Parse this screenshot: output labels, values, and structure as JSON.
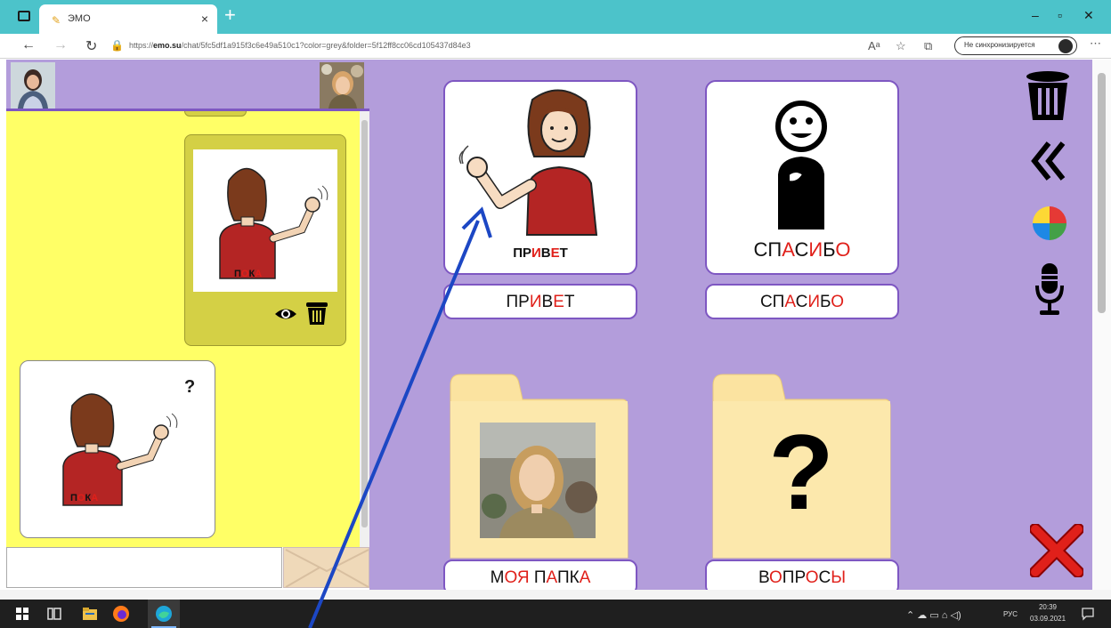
{
  "browser": {
    "tab_title": "ЭМО",
    "url_prefix": "https://",
    "url_host": "emo.su",
    "url_path": "/chat/5fc5df1a915f3c6e49a510c1?color=grey&folder=5f12ff8cc06cd105437d84e3",
    "sync_label": "Не синхронизируется"
  },
  "chat": {
    "sent_card_label_parts": [
      "П",
      "О",
      "К",
      "А"
    ],
    "received_card_label_parts": [
      "П",
      "О",
      "К",
      "А"
    ],
    "received_question_mark": "?"
  },
  "board": {
    "cards": [
      {
        "id": "privet",
        "label_parts": [
          "ПР",
          "И",
          "В",
          "Е",
          "Т"
        ],
        "caption_parts": [
          "ПР",
          "И",
          "В",
          "Е",
          "Т"
        ]
      },
      {
        "id": "spasibo",
        "label_parts": [
          "СП",
          "А",
          "С",
          "И",
          "Б",
          "О"
        ],
        "caption_parts": [
          "СП",
          "А",
          "С",
          "И",
          "Б",
          "О"
        ]
      }
    ],
    "folders": [
      {
        "id": "my-folder",
        "label_parts": [
          "М",
          "ОЯ",
          " П",
          "А",
          "ПК",
          "А"
        ]
      },
      {
        "id": "questions",
        "label_parts": [
          "В",
          "О",
          "ПР",
          "О",
          "С",
          "Ы"
        ],
        "icon_text": "?"
      }
    ]
  },
  "colors": {
    "board_bg": "#b39ddb",
    "chat_bg": "#ffff66",
    "accent_red": "#e0201a",
    "frame_purple": "#7e57c2",
    "arrow_blue": "#1c47c4"
  },
  "taskbar": {
    "lang": "РУС",
    "time": "20:39",
    "date": "03.09.2021"
  }
}
